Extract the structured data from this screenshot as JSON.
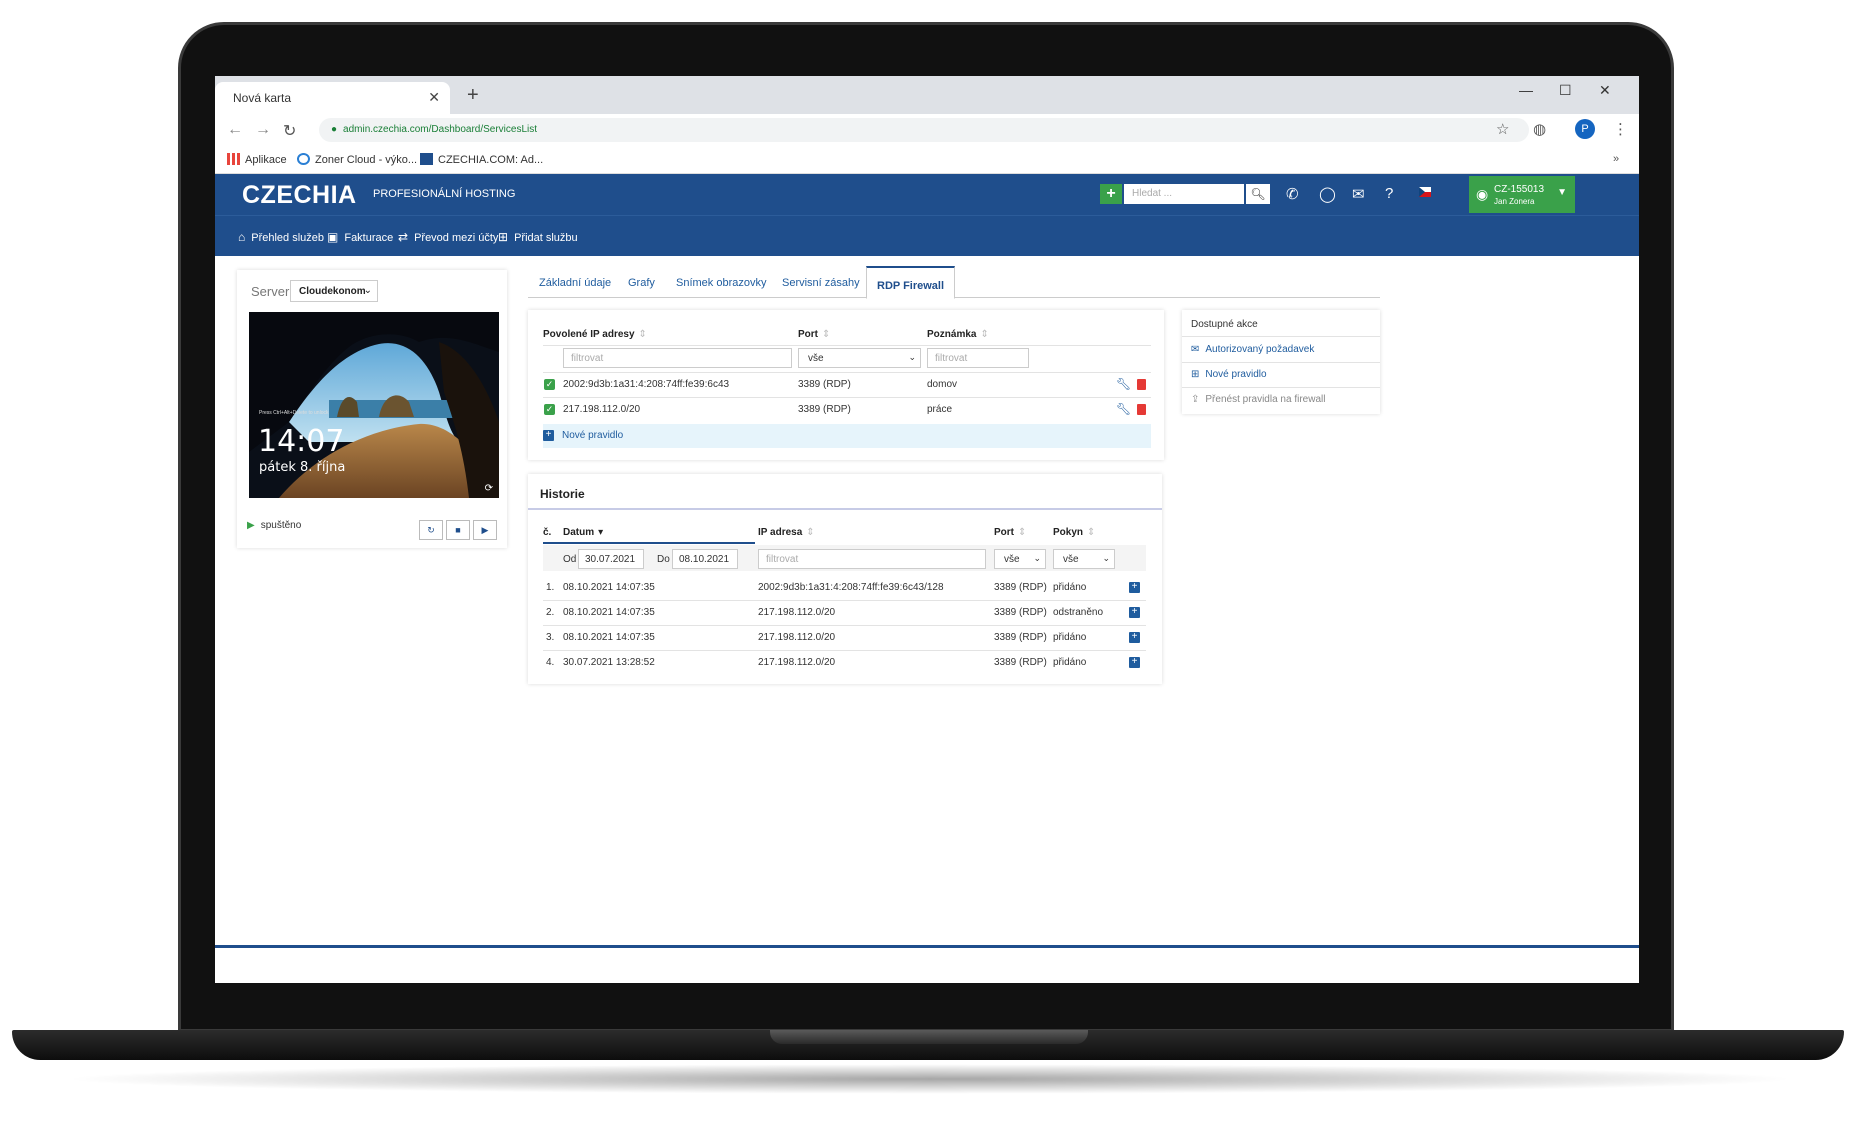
{
  "browser": {
    "tab_title": "Nová karta",
    "url": "admin.czechia.com/Dashboard/ServicesList",
    "profile_initial": "P",
    "bookmarks": [
      "Aplikace",
      "Zoner Cloud - výko...",
      "CZECHIA.COM: Ad..."
    ]
  },
  "header": {
    "logo": "CZECHIA",
    "tagline": "PROFESIONÁLNÍ HOSTING",
    "search_placeholder": "Hledat ...",
    "account_id": "CZ-155013",
    "account_name": "Jan Zonera"
  },
  "nav": {
    "items": [
      "Přehled služeb",
      "Fakturace",
      "Převod mezi účty",
      "Přidat službu"
    ]
  },
  "server": {
    "label": "Server",
    "selected": "Cloudekonom",
    "lock_time": "14:07",
    "lock_date": "pátek 8. října",
    "lock_hint": "Press Ctrl+Alt+Delete to unlock",
    "status": "spuštěno"
  },
  "tabs": [
    "Základní údaje",
    "Grafy",
    "Snímek obrazovky",
    "Servisní zásahy",
    "RDP Firewall"
  ],
  "firewall": {
    "headers": [
      "Povolené IP adresy",
      "Port",
      "Poznámka"
    ],
    "filter_placeholder": "filtrovat",
    "port_filter": "vše",
    "rows": [
      {
        "ip": "2002:9d3b:1a31:4:208:74ff:fe39:6c43",
        "port": "3389 (RDP)",
        "note": "domov"
      },
      {
        "ip": "217.198.112.0/20",
        "port": "3389 (RDP)",
        "note": "práce"
      }
    ],
    "new_rule": "Nové pravidlo"
  },
  "actions": {
    "title": "Dostupné akce",
    "items": [
      "Autorizovaný požadavek",
      "Nové pravidlo",
      "Přenést pravidla na firewall"
    ]
  },
  "history": {
    "title": "Historie",
    "headers": [
      "č.",
      "Datum",
      "IP adresa",
      "Port",
      "Pokyn"
    ],
    "from_label": "Od",
    "from": "30.07.2021",
    "to_label": "Do",
    "to": "08.10.2021",
    "filter_placeholder": "filtrovat",
    "port_filter": "vše",
    "action_filter": "vše",
    "rows": [
      {
        "n": "1.",
        "date": "08.10.2021 14:07:35",
        "ip": "2002:9d3b:1a31:4:208:74ff:fe39:6c43/128",
        "port": "3389 (RDP)",
        "action": "přidáno"
      },
      {
        "n": "2.",
        "date": "08.10.2021 14:07:35",
        "ip": "217.198.112.0/20",
        "port": "3389 (RDP)",
        "action": "odstraněno"
      },
      {
        "n": "3.",
        "date": "08.10.2021 14:07:35",
        "ip": "217.198.112.0/20",
        "port": "3389 (RDP)",
        "action": "přidáno"
      },
      {
        "n": "4.",
        "date": "30.07.2021 13:28:52",
        "ip": "217.198.112.0/20",
        "port": "3389 (RDP)",
        "action": "přidáno"
      }
    ]
  },
  "colors": {
    "brand": "#1f4e8c",
    "accent_green": "#3aa14a",
    "danger": "#e53935"
  }
}
